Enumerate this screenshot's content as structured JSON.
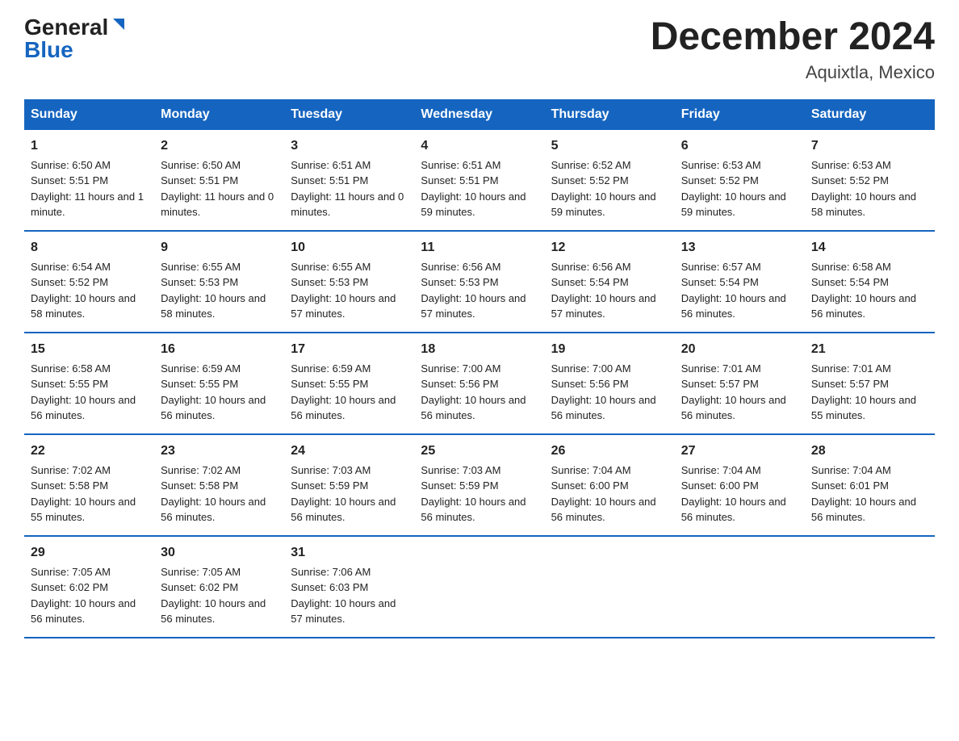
{
  "header": {
    "logo_general": "General",
    "logo_blue": "Blue",
    "month_title": "December 2024",
    "location": "Aquixtla, Mexico"
  },
  "days_of_week": [
    "Sunday",
    "Monday",
    "Tuesday",
    "Wednesday",
    "Thursday",
    "Friday",
    "Saturday"
  ],
  "weeks": [
    [
      {
        "day": "1",
        "sunrise": "6:50 AM",
        "sunset": "5:51 PM",
        "daylight": "11 hours and 1 minute."
      },
      {
        "day": "2",
        "sunrise": "6:50 AM",
        "sunset": "5:51 PM",
        "daylight": "11 hours and 0 minutes."
      },
      {
        "day": "3",
        "sunrise": "6:51 AM",
        "sunset": "5:51 PM",
        "daylight": "11 hours and 0 minutes."
      },
      {
        "day": "4",
        "sunrise": "6:51 AM",
        "sunset": "5:51 PM",
        "daylight": "10 hours and 59 minutes."
      },
      {
        "day": "5",
        "sunrise": "6:52 AM",
        "sunset": "5:52 PM",
        "daylight": "10 hours and 59 minutes."
      },
      {
        "day": "6",
        "sunrise": "6:53 AM",
        "sunset": "5:52 PM",
        "daylight": "10 hours and 59 minutes."
      },
      {
        "day": "7",
        "sunrise": "6:53 AM",
        "sunset": "5:52 PM",
        "daylight": "10 hours and 58 minutes."
      }
    ],
    [
      {
        "day": "8",
        "sunrise": "6:54 AM",
        "sunset": "5:52 PM",
        "daylight": "10 hours and 58 minutes."
      },
      {
        "day": "9",
        "sunrise": "6:55 AM",
        "sunset": "5:53 PM",
        "daylight": "10 hours and 58 minutes."
      },
      {
        "day": "10",
        "sunrise": "6:55 AM",
        "sunset": "5:53 PM",
        "daylight": "10 hours and 57 minutes."
      },
      {
        "day": "11",
        "sunrise": "6:56 AM",
        "sunset": "5:53 PM",
        "daylight": "10 hours and 57 minutes."
      },
      {
        "day": "12",
        "sunrise": "6:56 AM",
        "sunset": "5:54 PM",
        "daylight": "10 hours and 57 minutes."
      },
      {
        "day": "13",
        "sunrise": "6:57 AM",
        "sunset": "5:54 PM",
        "daylight": "10 hours and 56 minutes."
      },
      {
        "day": "14",
        "sunrise": "6:58 AM",
        "sunset": "5:54 PM",
        "daylight": "10 hours and 56 minutes."
      }
    ],
    [
      {
        "day": "15",
        "sunrise": "6:58 AM",
        "sunset": "5:55 PM",
        "daylight": "10 hours and 56 minutes."
      },
      {
        "day": "16",
        "sunrise": "6:59 AM",
        "sunset": "5:55 PM",
        "daylight": "10 hours and 56 minutes."
      },
      {
        "day": "17",
        "sunrise": "6:59 AM",
        "sunset": "5:55 PM",
        "daylight": "10 hours and 56 minutes."
      },
      {
        "day": "18",
        "sunrise": "7:00 AM",
        "sunset": "5:56 PM",
        "daylight": "10 hours and 56 minutes."
      },
      {
        "day": "19",
        "sunrise": "7:00 AM",
        "sunset": "5:56 PM",
        "daylight": "10 hours and 56 minutes."
      },
      {
        "day": "20",
        "sunrise": "7:01 AM",
        "sunset": "5:57 PM",
        "daylight": "10 hours and 56 minutes."
      },
      {
        "day": "21",
        "sunrise": "7:01 AM",
        "sunset": "5:57 PM",
        "daylight": "10 hours and 55 minutes."
      }
    ],
    [
      {
        "day": "22",
        "sunrise": "7:02 AM",
        "sunset": "5:58 PM",
        "daylight": "10 hours and 55 minutes."
      },
      {
        "day": "23",
        "sunrise": "7:02 AM",
        "sunset": "5:58 PM",
        "daylight": "10 hours and 56 minutes."
      },
      {
        "day": "24",
        "sunrise": "7:03 AM",
        "sunset": "5:59 PM",
        "daylight": "10 hours and 56 minutes."
      },
      {
        "day": "25",
        "sunrise": "7:03 AM",
        "sunset": "5:59 PM",
        "daylight": "10 hours and 56 minutes."
      },
      {
        "day": "26",
        "sunrise": "7:04 AM",
        "sunset": "6:00 PM",
        "daylight": "10 hours and 56 minutes."
      },
      {
        "day": "27",
        "sunrise": "7:04 AM",
        "sunset": "6:00 PM",
        "daylight": "10 hours and 56 minutes."
      },
      {
        "day": "28",
        "sunrise": "7:04 AM",
        "sunset": "6:01 PM",
        "daylight": "10 hours and 56 minutes."
      }
    ],
    [
      {
        "day": "29",
        "sunrise": "7:05 AM",
        "sunset": "6:02 PM",
        "daylight": "10 hours and 56 minutes."
      },
      {
        "day": "30",
        "sunrise": "7:05 AM",
        "sunset": "6:02 PM",
        "daylight": "10 hours and 56 minutes."
      },
      {
        "day": "31",
        "sunrise": "7:06 AM",
        "sunset": "6:03 PM",
        "daylight": "10 hours and 57 minutes."
      },
      null,
      null,
      null,
      null
    ]
  ],
  "labels": {
    "sunrise_prefix": "Sunrise: ",
    "sunset_prefix": "Sunset: ",
    "daylight_prefix": "Daylight: "
  }
}
